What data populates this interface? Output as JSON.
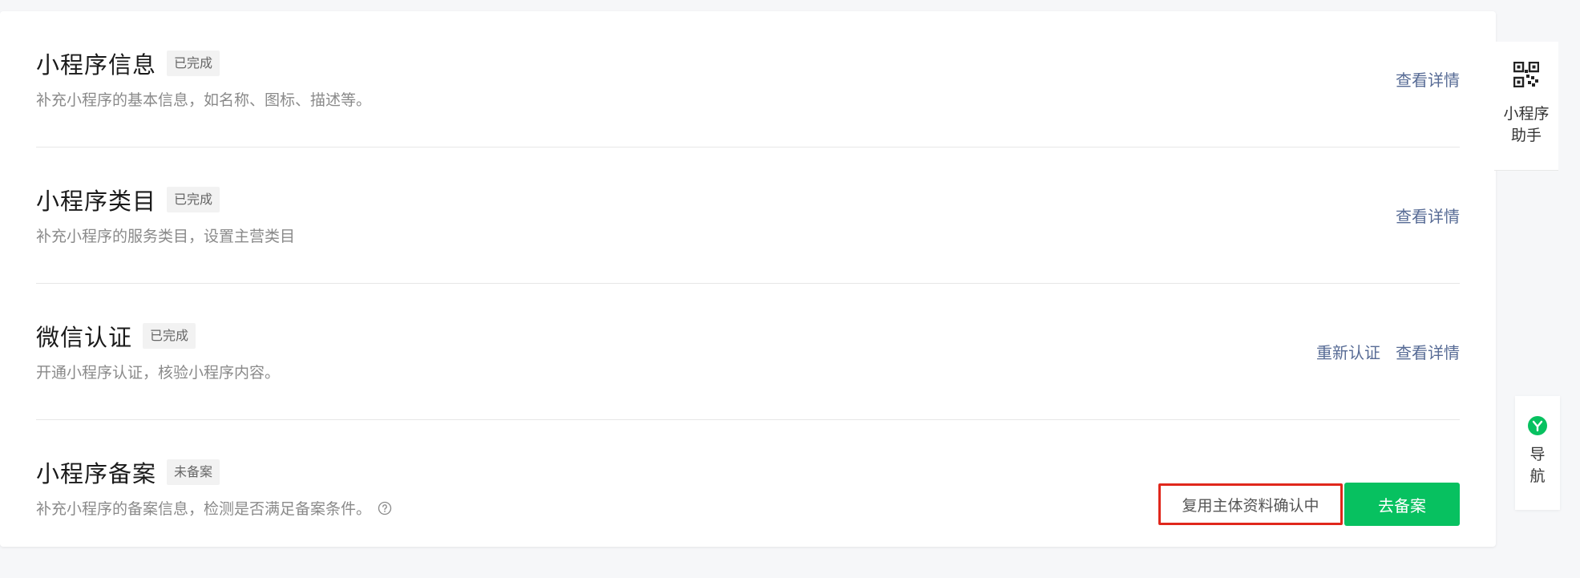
{
  "sections": [
    {
      "title": "小程序信息",
      "badge": "已完成",
      "desc": "补充小程序的基本信息，如名称、图标、描述等。",
      "actions": [
        "查看详情"
      ]
    },
    {
      "title": "小程序类目",
      "badge": "已完成",
      "desc": "补充小程序的服务类目，设置主营类目",
      "actions": [
        "查看详情"
      ]
    },
    {
      "title": "微信认证",
      "badge": "已完成",
      "desc": "开通小程序认证，核验小程序内容。",
      "actions": [
        "重新认证",
        "查看详情"
      ]
    },
    {
      "title": "小程序备案",
      "badge": "未备案",
      "desc": "补充小程序的备案信息，检测是否满足备案条件。",
      "status_text": "复用主体资料确认中",
      "primary_button": "去备案"
    }
  ],
  "side": {
    "helper_label": "小程序助手",
    "nav_label": "导航"
  },
  "colors": {
    "accent_link": "#576b95",
    "primary": "#07c160",
    "highlight": "#e0271c"
  },
  "icons": [
    "qr-code-icon",
    "help-circle-icon",
    "nav-badge-icon"
  ]
}
